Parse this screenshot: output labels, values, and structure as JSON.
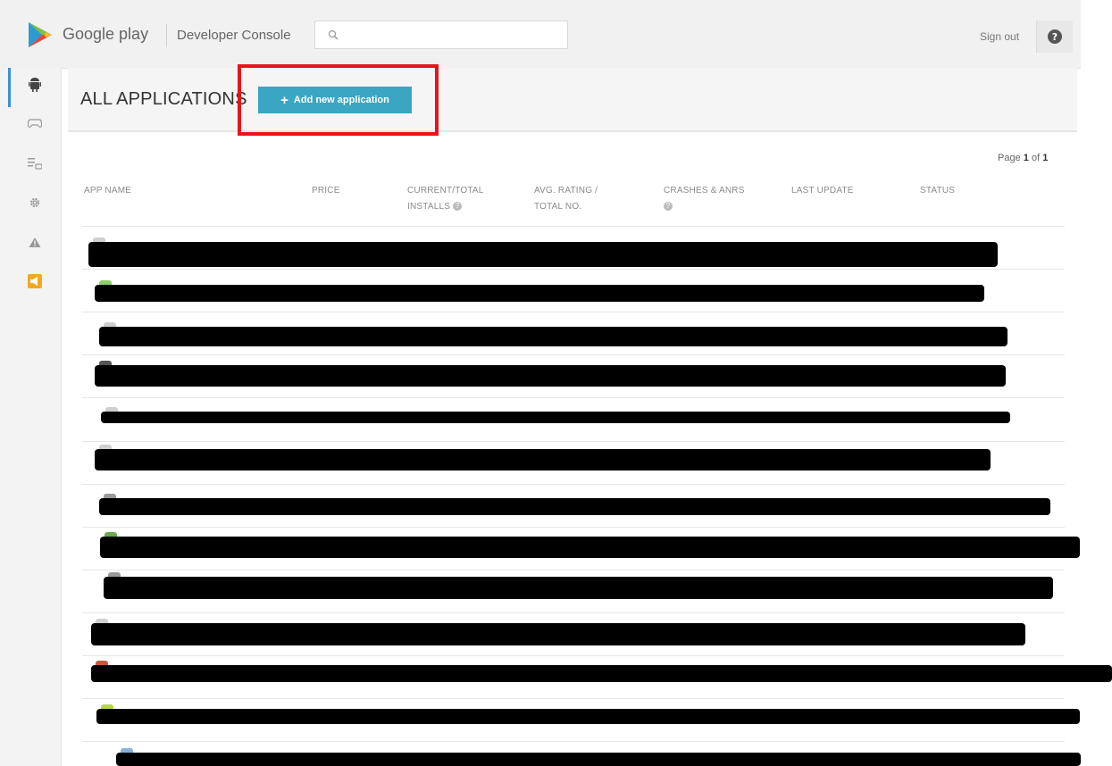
{
  "header": {
    "brand": "Google play",
    "console": "Developer Console",
    "search_placeholder": "",
    "signout": "Sign out",
    "help": "?"
  },
  "page": {
    "title": "ALL APPLICATIONS",
    "add_button": "Add new application",
    "add_plus": "+",
    "page_label": "Page",
    "page_current": "1",
    "page_of": "of",
    "page_total": "1"
  },
  "table": {
    "columns": [
      {
        "line1": "APP NAME",
        "line2": ""
      },
      {
        "line1": "PRICE",
        "line2": ""
      },
      {
        "line1": "CURRENT/TOTAL",
        "line2": "INSTALLS"
      },
      {
        "line1": "AVG. RATING /",
        "line2": "TOTAL NO."
      },
      {
        "line1": "CRASHES & ANRS",
        "line2": ""
      },
      {
        "line1": "LAST UPDATE",
        "line2": ""
      },
      {
        "line1": "STATUS",
        "line2": ""
      }
    ],
    "row_count": 13
  },
  "sidebar": {
    "items": [
      {
        "icon": "android-icon",
        "active": true
      },
      {
        "icon": "gamepad-icon",
        "active": false
      },
      {
        "icon": "list-icon",
        "active": false
      },
      {
        "icon": "gear-icon",
        "active": false
      },
      {
        "icon": "warning-icon",
        "active": false
      },
      {
        "icon": "announcement-icon",
        "active": false
      }
    ]
  },
  "colors": {
    "accent": "#3aa6c2",
    "highlight": "#e8141a",
    "active_bar": "#3b8fd8"
  }
}
